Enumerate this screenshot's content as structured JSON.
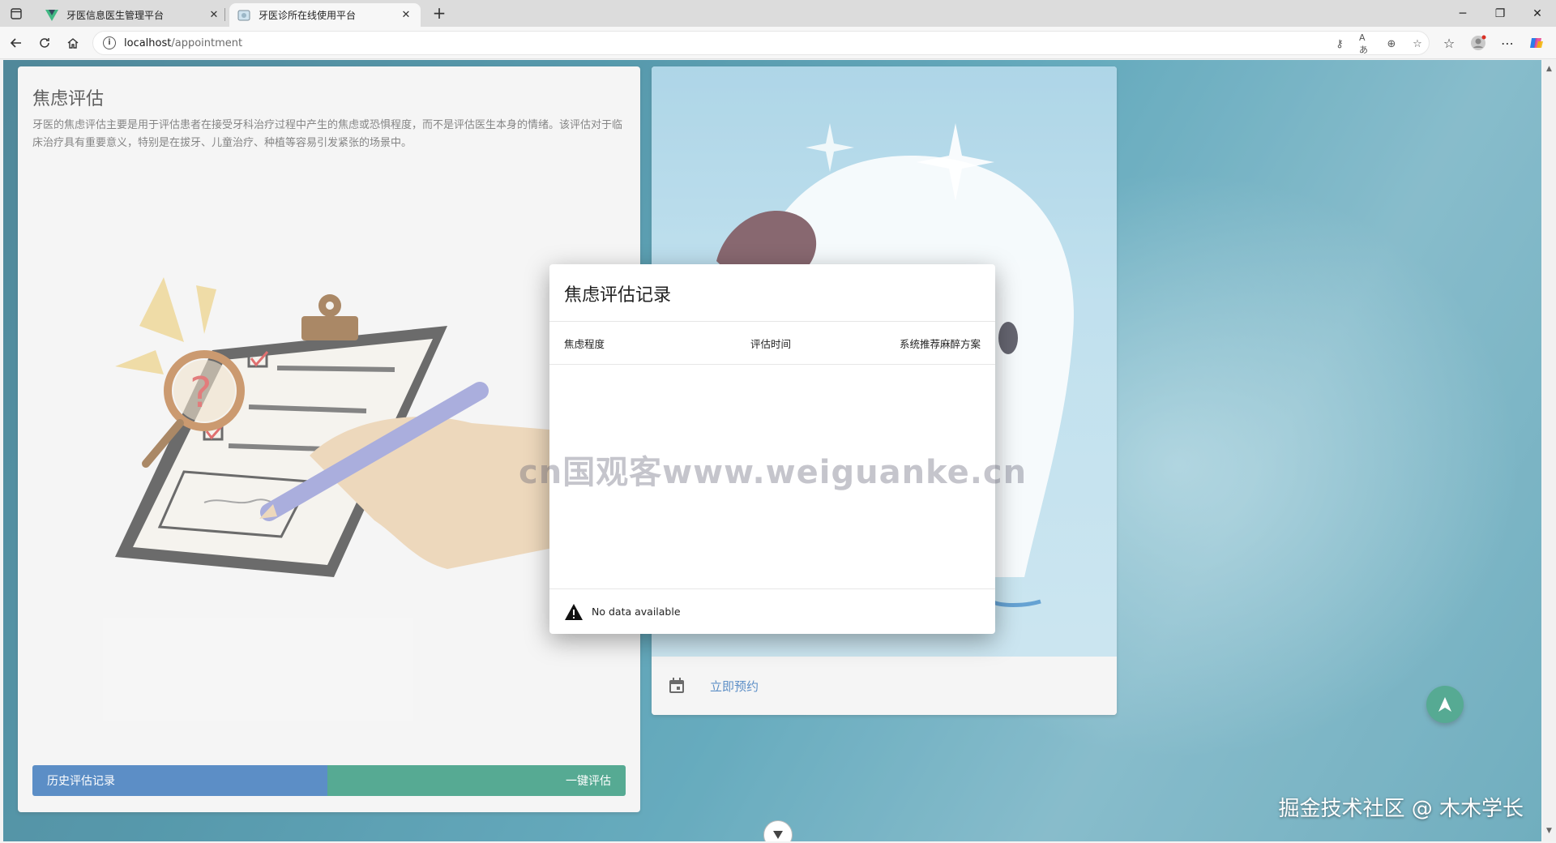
{
  "browser": {
    "tabs": [
      {
        "title": "牙医信息医生管理平台",
        "active": false
      },
      {
        "title": "牙医诊所在线使用平台",
        "active": true
      }
    ],
    "address": {
      "host": "localhost",
      "path": "/appointment"
    }
  },
  "left_card": {
    "title": "焦虑评估",
    "description": "牙医的焦虑评估主要是用于评估患者在接受牙科治疗过程中产生的焦虑或恐惧程度，而不是评估医生本身的情绪。该评估对于临床治疗具有重要意义，特别是在拔牙、儿童治疗、种植等容易引发紧张的场景中。",
    "history_button": "历史评估记录",
    "assess_button": "一键评估"
  },
  "right_card": {
    "book_link": "立即预约"
  },
  "dialog": {
    "title": "焦虑评估记录",
    "columns": [
      "焦虑程度",
      "评估时间",
      "系统推荐麻醉方案"
    ],
    "empty_text": "No data available"
  },
  "watermark": "cn国观客www.weiguanke.cn",
  "credit": "掘金技术社区 @ 木木学长",
  "colors": {
    "primary": "#1e63b0",
    "accent": "#168a6a"
  }
}
